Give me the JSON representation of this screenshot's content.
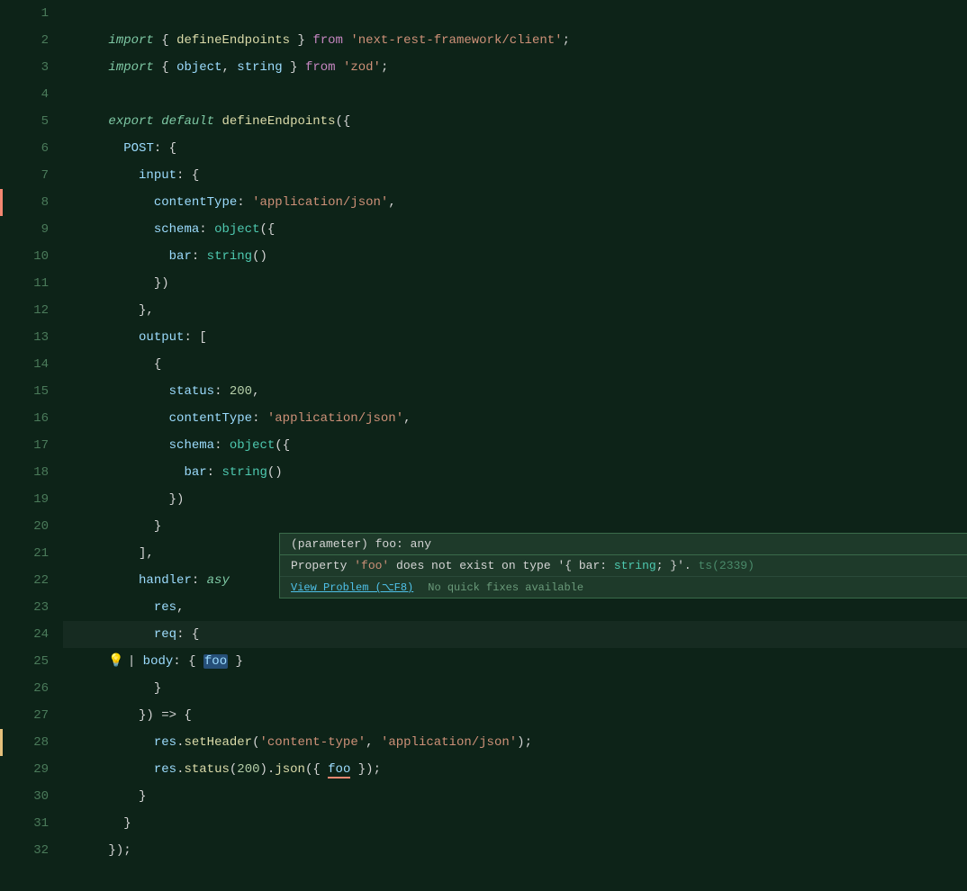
{
  "editor": {
    "background": "#0d2318",
    "lines": [
      {
        "num": 1,
        "tokens": [
          {
            "t": "italic-green",
            "v": "import"
          },
          {
            "t": "white",
            "v": " { "
          },
          {
            "t": "yellow",
            "v": "defineEndpoints"
          },
          {
            "t": "white",
            "v": " } "
          },
          {
            "t": "purple",
            "v": "from"
          },
          {
            "t": "white",
            "v": " "
          },
          {
            "t": "orange",
            "v": "'next-rest-framework/client'"
          },
          {
            "t": "white",
            "v": ";"
          }
        ],
        "gutter": null
      },
      {
        "num": 2,
        "tokens": [
          {
            "t": "italic-green",
            "v": "import"
          },
          {
            "t": "white",
            "v": " { "
          },
          {
            "t": "light-blue",
            "v": "object"
          },
          {
            "t": "white",
            "v": ", "
          },
          {
            "t": "light-blue",
            "v": "string"
          },
          {
            "t": "white",
            "v": " } "
          },
          {
            "t": "purple",
            "v": "from"
          },
          {
            "t": "white",
            "v": " "
          },
          {
            "t": "orange",
            "v": "'zod'"
          },
          {
            "t": "white",
            "v": ";"
          }
        ],
        "gutter": null
      },
      {
        "num": 3,
        "tokens": [],
        "gutter": null
      },
      {
        "num": 4,
        "tokens": [
          {
            "t": "italic-green",
            "v": "export"
          },
          {
            "t": "white",
            "v": " "
          },
          {
            "t": "italic-green",
            "v": "default"
          },
          {
            "t": "white",
            "v": " "
          },
          {
            "t": "yellow",
            "v": "defineEndpoints"
          },
          {
            "t": "white",
            "v": "({"
          }
        ],
        "gutter": null
      },
      {
        "num": 5,
        "tokens": [
          {
            "t": "white",
            "v": "  "
          },
          {
            "t": "light-blue",
            "v": "POST"
          },
          {
            "t": "white",
            "v": ": {"
          }
        ],
        "gutter": null
      },
      {
        "num": 6,
        "tokens": [
          {
            "t": "white",
            "v": "    "
          },
          {
            "t": "light-blue",
            "v": "input"
          },
          {
            "t": "white",
            "v": ": {"
          }
        ],
        "gutter": null
      },
      {
        "num": 7,
        "tokens": [
          {
            "t": "white",
            "v": "      "
          },
          {
            "t": "light-blue",
            "v": "contentType"
          },
          {
            "t": "white",
            "v": ": "
          },
          {
            "t": "orange",
            "v": "'application/json'"
          },
          {
            "t": "white",
            "v": ","
          }
        ],
        "gutter": null
      },
      {
        "num": 8,
        "tokens": [
          {
            "t": "white",
            "v": "      "
          },
          {
            "t": "light-blue",
            "v": "schema"
          },
          {
            "t": "white",
            "v": ": "
          },
          {
            "t": "teal",
            "v": "object"
          },
          {
            "t": "white",
            "v": "({"
          }
        ],
        "gutter": "error"
      },
      {
        "num": 9,
        "tokens": [
          {
            "t": "white",
            "v": "        "
          },
          {
            "t": "light-blue",
            "v": "bar"
          },
          {
            "t": "white",
            "v": ": "
          },
          {
            "t": "teal",
            "v": "string"
          },
          {
            "t": "white",
            "v": "()"
          }
        ],
        "gutter": null
      },
      {
        "num": 10,
        "tokens": [
          {
            "t": "white",
            "v": "      "
          },
          {
            "t": "white",
            "v": "})"
          }
        ],
        "gutter": null
      },
      {
        "num": 11,
        "tokens": [
          {
            "t": "white",
            "v": "    "
          },
          {
            "t": "white",
            "v": "},"
          }
        ],
        "gutter": null
      },
      {
        "num": 12,
        "tokens": [
          {
            "t": "white",
            "v": "    "
          },
          {
            "t": "light-blue",
            "v": "output"
          },
          {
            "t": "white",
            "v": ": ["
          }
        ],
        "gutter": null
      },
      {
        "num": 13,
        "tokens": [
          {
            "t": "white",
            "v": "      {"
          }
        ],
        "gutter": null
      },
      {
        "num": 14,
        "tokens": [
          {
            "t": "white",
            "v": "        "
          },
          {
            "t": "light-blue",
            "v": "status"
          },
          {
            "t": "white",
            "v": ": "
          },
          {
            "t": "number-color",
            "v": "200"
          },
          {
            "t": "white",
            "v": ","
          }
        ],
        "gutter": null
      },
      {
        "num": 15,
        "tokens": [
          {
            "t": "white",
            "v": "        "
          },
          {
            "t": "light-blue",
            "v": "contentType"
          },
          {
            "t": "white",
            "v": ": "
          },
          {
            "t": "orange",
            "v": "'application/json'"
          },
          {
            "t": "white",
            "v": ","
          }
        ],
        "gutter": null
      },
      {
        "num": 16,
        "tokens": [
          {
            "t": "white",
            "v": "        "
          },
          {
            "t": "light-blue",
            "v": "schema"
          },
          {
            "t": "white",
            "v": ": "
          },
          {
            "t": "teal",
            "v": "object"
          },
          {
            "t": "white",
            "v": "({"
          }
        ],
        "gutter": null
      },
      {
        "num": 17,
        "tokens": [
          {
            "t": "white",
            "v": "          "
          },
          {
            "t": "light-blue",
            "v": "bar"
          },
          {
            "t": "white",
            "v": ": "
          },
          {
            "t": "teal",
            "v": "string"
          },
          {
            "t": "white",
            "v": "()"
          }
        ],
        "gutter": null
      },
      {
        "num": 18,
        "tokens": [
          {
            "t": "white",
            "v": "        "
          },
          {
            "t": "white",
            "v": "})"
          }
        ],
        "gutter": null
      },
      {
        "num": 19,
        "tokens": [
          {
            "t": "white",
            "v": "      }"
          }
        ],
        "gutter": null
      },
      {
        "num": 20,
        "tokens": [
          {
            "t": "white",
            "v": "    ],"
          }
        ],
        "gutter": null
      },
      {
        "num": 21,
        "tokens": [
          {
            "t": "white",
            "v": "    "
          },
          {
            "t": "light-blue",
            "v": "handler"
          },
          {
            "t": "white",
            "v": ": "
          },
          {
            "t": "italic-green",
            "v": "asy"
          }
        ],
        "gutter": null
      },
      {
        "num": 22,
        "tokens": [
          {
            "t": "white",
            "v": "      "
          },
          {
            "t": "light-blue",
            "v": "res"
          },
          {
            "t": "white",
            "v": ","
          }
        ],
        "gutter": null
      },
      {
        "num": 23,
        "tokens": [
          {
            "t": "white",
            "v": "      "
          },
          {
            "t": "light-blue",
            "v": "req"
          },
          {
            "t": "white",
            "v": ": {"
          }
        ],
        "gutter": null
      },
      {
        "num": 24,
        "tokens": [
          {
            "t": "white",
            "v": "      | "
          },
          {
            "t": "light-blue",
            "v": "body"
          },
          {
            "t": "white",
            "v": ": { "
          },
          {
            "t": "selected",
            "v": "foo"
          },
          {
            "t": "white",
            "v": " }"
          }
        ],
        "gutter": "lightbulb"
      },
      {
        "num": 25,
        "tokens": [
          {
            "t": "white",
            "v": "      }"
          }
        ],
        "gutter": null
      },
      {
        "num": 26,
        "tokens": [
          {
            "t": "white",
            "v": "    }) => {"
          }
        ],
        "gutter": null
      },
      {
        "num": 27,
        "tokens": [
          {
            "t": "white",
            "v": "      "
          },
          {
            "t": "light-blue",
            "v": "res"
          },
          {
            "t": "white",
            "v": "."
          },
          {
            "t": "yellow",
            "v": "setHeader"
          },
          {
            "t": "white",
            "v": "("
          },
          {
            "t": "orange",
            "v": "'content-type'"
          },
          {
            "t": "white",
            "v": ", "
          },
          {
            "t": "orange",
            "v": "'application/json'"
          },
          {
            "t": "white",
            "v": "');"
          }
        ],
        "gutter": null
      },
      {
        "num": 28,
        "tokens": [
          {
            "t": "white",
            "v": "      "
          },
          {
            "t": "light-blue",
            "v": "res"
          },
          {
            "t": "white",
            "v": "."
          },
          {
            "t": "yellow",
            "v": "status"
          },
          {
            "t": "white",
            "v": "("
          },
          {
            "t": "number-color",
            "v": "200"
          },
          {
            "t": "white",
            "v": ")"
          },
          {
            "t": "white",
            "v": "."
          },
          {
            "t": "yellow",
            "v": "json"
          },
          {
            "t": "white",
            "v": "({ "
          },
          {
            "t": "error-squiggle",
            "v": "foo"
          },
          {
            "t": "white",
            "v": " });"
          }
        ],
        "gutter": "warning"
      },
      {
        "num": 29,
        "tokens": [
          {
            "t": "white",
            "v": "    }"
          }
        ],
        "gutter": null
      },
      {
        "num": 30,
        "tokens": [
          {
            "t": "white",
            "v": "  }"
          }
        ],
        "gutter": null
      },
      {
        "num": 31,
        "tokens": [
          {
            "t": "white",
            "v": "});"
          }
        ],
        "gutter": null
      },
      {
        "num": 32,
        "tokens": [],
        "gutter": null
      }
    ],
    "tooltip": {
      "header": "(parameter) foo: any",
      "body_prefix": "Property ",
      "body_prop": "'foo'",
      "body_middle": " does not exist on type '{ bar: ",
      "body_type": "string",
      "body_suffix": "; }'. ts(2339)",
      "link_text": "View Problem (⌥F8)",
      "no_fix": "No quick fixes available"
    }
  }
}
